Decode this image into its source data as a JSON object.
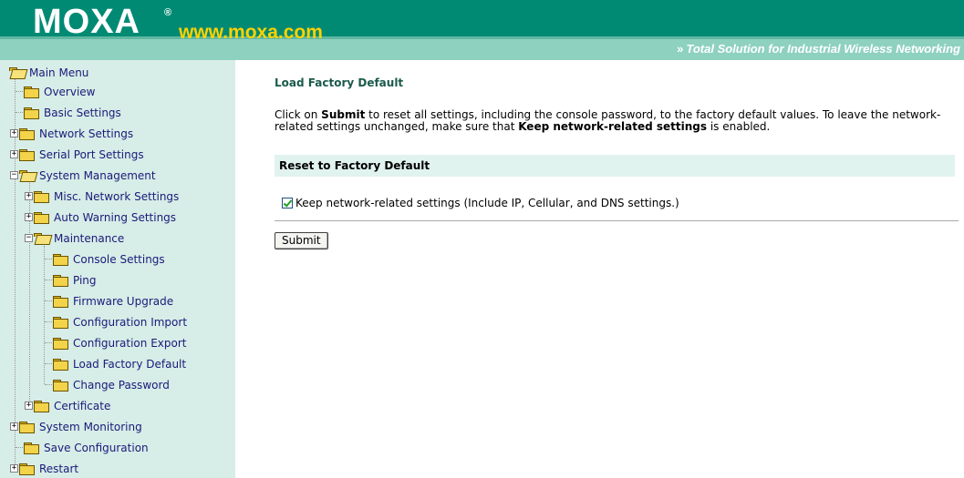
{
  "header": {
    "logo": "MOXA",
    "logo_reg": "®",
    "url": "www.moxa.com",
    "tagline_arrows": "»",
    "tagline": "Total Solution for Industrial Wireless Networking"
  },
  "sidebar": {
    "items": [
      {
        "label": "Main Menu"
      },
      {
        "label": "Overview"
      },
      {
        "label": "Basic Settings"
      },
      {
        "label": "Network Settings"
      },
      {
        "label": "Serial Port Settings"
      },
      {
        "label": "System Management"
      },
      {
        "label": "Misc. Network Settings"
      },
      {
        "label": "Auto Warning Settings"
      },
      {
        "label": "Maintenance"
      },
      {
        "label": "Console Settings"
      },
      {
        "label": "Ping"
      },
      {
        "label": "Firmware Upgrade"
      },
      {
        "label": "Configuration Import"
      },
      {
        "label": "Configuration Export"
      },
      {
        "label": "Load Factory Default"
      },
      {
        "label": "Change Password"
      },
      {
        "label": "Certificate"
      },
      {
        "label": "System Monitoring"
      },
      {
        "label": "Save Configuration"
      },
      {
        "label": "Restart"
      }
    ]
  },
  "main": {
    "title": "Load Factory Default",
    "desc_1": "Click on ",
    "desc_2": "Submit",
    "desc_3": " to reset all settings, including the console password, to the factory default values. To leave the network-related settings unchanged, make sure that ",
    "desc_4": "Keep network-related settings",
    "desc_5": " is enabled.",
    "section_title": "Reset to Factory Default",
    "checkbox_label": "Keep network-related settings (Include IP, Cellular, and DNS settings.)",
    "checkbox_checked": true,
    "submit_label": "Submit"
  },
  "colors": {
    "header_dark": "#008a74",
    "header_light": "#8ed1bf",
    "sidebar_bg": "#d7ede7",
    "url_yellow": "#ffd200"
  }
}
